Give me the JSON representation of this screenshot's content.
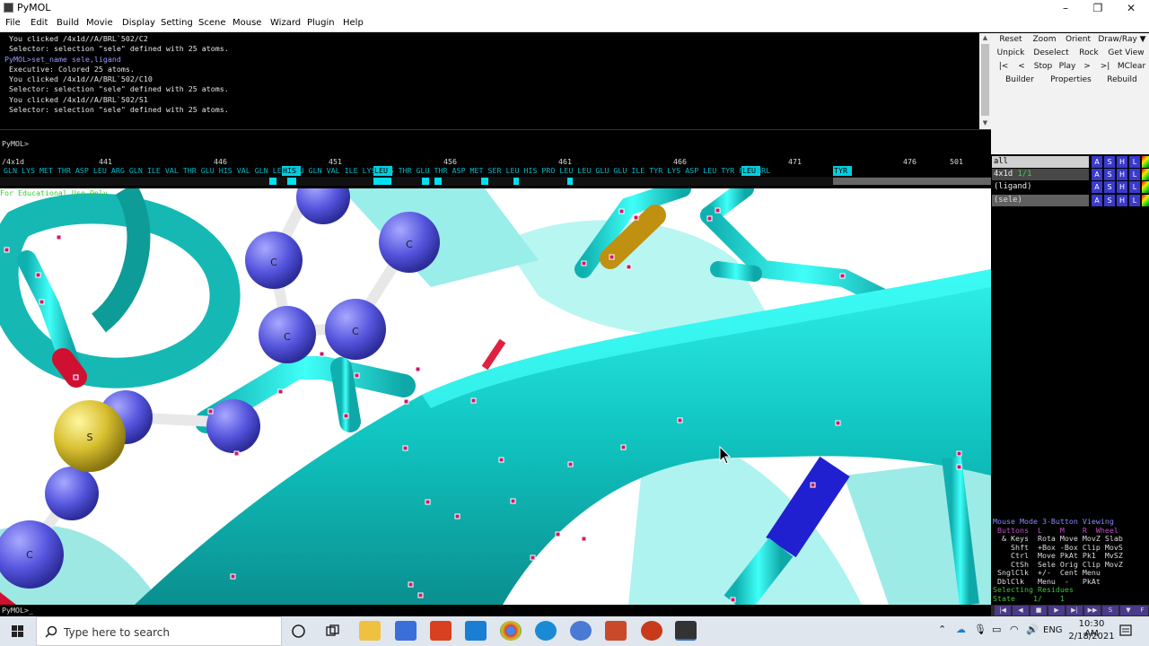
{
  "window": {
    "title": "PyMOL",
    "controls": [
      "–",
      "❐",
      "✕"
    ]
  },
  "menu": [
    "File",
    "Edit",
    "Build",
    "Movie",
    "Display",
    "Setting",
    "Scene",
    "Mouse",
    "Wizard",
    "Plugin",
    "Help"
  ],
  "console_lines": [
    {
      "text": " You clicked /4x1d//A/BRL`502/C2",
      "cmd": false
    },
    {
      "text": " Selector: selection \"sele\" defined with 25 atoms.",
      "cmd": false
    },
    {
      "text": "PyMOL>set_name sele,ligand",
      "cmd": true
    },
    {
      "text": " Executive: Colored 25 atoms.",
      "cmd": false
    },
    {
      "text": " You clicked /4x1d//A/BRL`502/C10",
      "cmd": false
    },
    {
      "text": " Selector: selection \"sele\" defined with 25 atoms.",
      "cmd": false
    },
    {
      "text": " You clicked /4x1d//A/BRL`502/S1",
      "cmd": false
    },
    {
      "text": " Selector: selection \"sele\" defined with 25 atoms.",
      "cmd": false
    }
  ],
  "prompt": {
    "label": "PyMOL>",
    "value": ""
  },
  "buttons": {
    "row1": [
      "Reset",
      "Zoom",
      "Orient",
      "Draw/Ray ▼"
    ],
    "row2": [
      "Unpick",
      "Deselect",
      "Rock",
      "Get View"
    ],
    "row3": [
      "|<",
      "<",
      "Stop",
      "Play",
      ">",
      ">|",
      "MClear"
    ],
    "row4": [
      "Builder",
      "Properties",
      "Rebuild"
    ]
  },
  "sequence": {
    "object": "/4x1d",
    "numbers": [
      "441",
      "446",
      "451",
      "456",
      "461",
      "466",
      "471",
      "476",
      "501"
    ],
    "residues": "GLN LYS MET THR ASP LEU ARG GLN ILE VAL THR GLU HIS VAL GLN LEU LEU GLN VAL ILE LYS LYS THR GLU THR ASP MET SER LEU HIS PRO LEU LEU GLU GLU ILE TYR LYS ASP LEU TYR FMT BRL",
    "highlighted": [
      "HIS",
      "LEU",
      "LEU",
      "TYR"
    ]
  },
  "watermark": "For Educational Use Only",
  "objects": [
    {
      "name": "all",
      "state": ""
    },
    {
      "name": "4x1d",
      "state": "1/1"
    },
    {
      "name": "(ligand)",
      "state": ""
    },
    {
      "name": "(sele)",
      "state": ""
    }
  ],
  "object_actions": [
    "A",
    "S",
    "H",
    "L",
    ""
  ],
  "atom_labels": [
    "C",
    "C",
    "C",
    "C",
    "S",
    "C"
  ],
  "mouse_panel": [
    {
      "text": "Mouse Mode 3-Button Viewing",
      "color": "#8a8aff"
    },
    {
      "text": " Buttons  L    M    R  Wheel",
      "color": "#c050c0"
    },
    {
      "text": "  & Keys  Rota Move MovZ Slab",
      "color": "#dddddd"
    },
    {
      "text": "    Shft  +Box -Box Clip MovS",
      "color": "#dddddd"
    },
    {
      "text": "    Ctrl  Move PkAt Pk1  MvSZ",
      "color": "#dddddd"
    },
    {
      "text": "    CtSh  Sele Orig Clip MovZ",
      "color": "#dddddd"
    },
    {
      "text": " SnglClk  +/-  Cent Menu",
      "color": "#dddddd"
    },
    {
      "text": " DblClk   Menu  -   PkAt",
      "color": "#dddddd"
    },
    {
      "text": "Selecting Residues",
      "color": "#40c040"
    },
    {
      "text": "State    1/    1",
      "color": "#40c040"
    }
  ],
  "bottom_prompt": "PyMOL>_",
  "taskbar": {
    "search_placeholder": "Type here to search",
    "language": "ENG",
    "time": "10:30 AM",
    "date": "2/18/2021"
  }
}
